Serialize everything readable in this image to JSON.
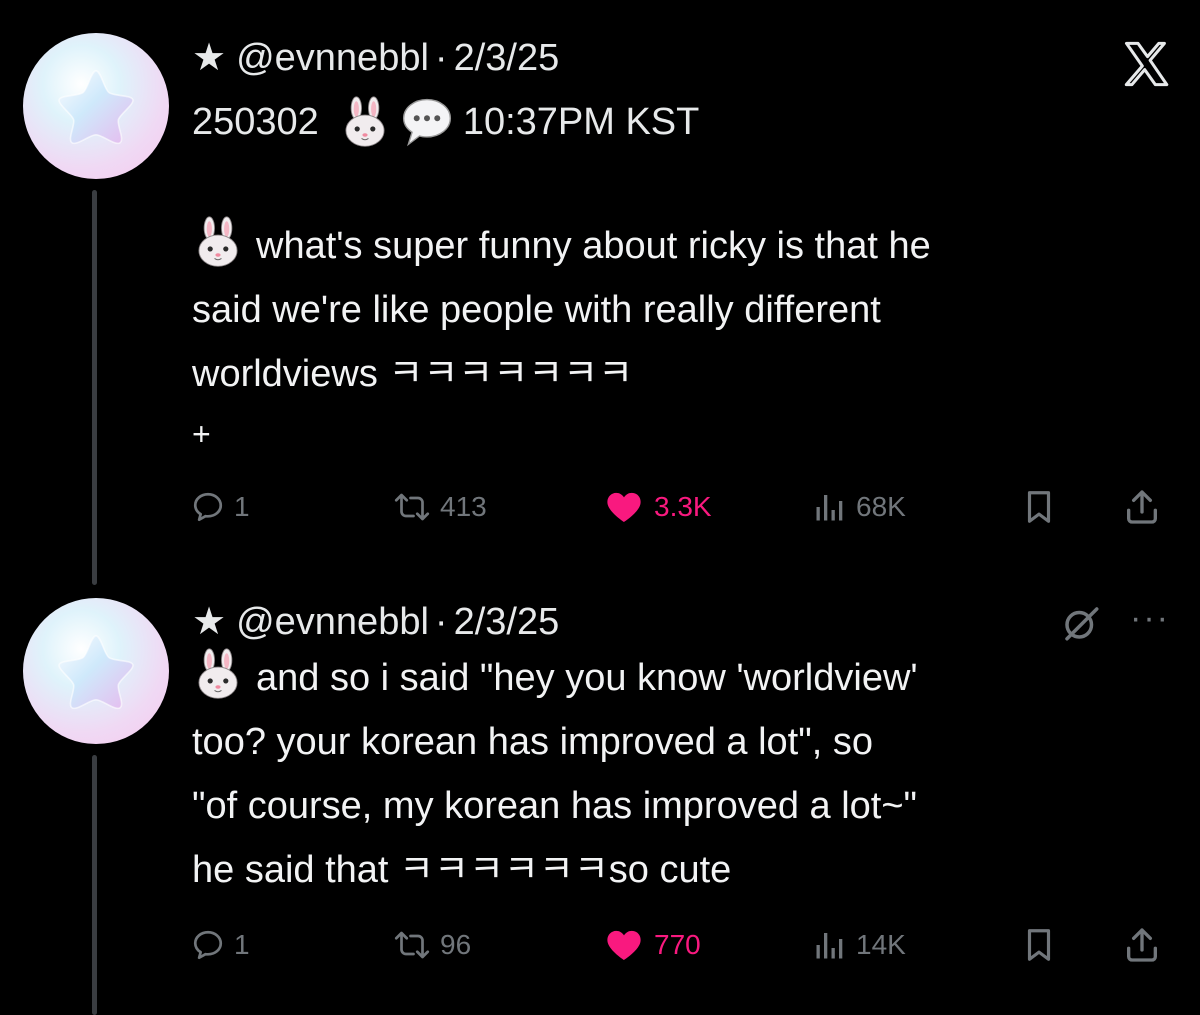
{
  "colors": {
    "background": "#000000",
    "text": "#e7e9ea",
    "muted": "#71767b",
    "like": "#f9197f",
    "thread_line": "#3a3d41"
  },
  "app_logo": "x-logo-icon",
  "tweets": [
    {
      "star": "★",
      "handle": "@evnnebbl",
      "separator": "·",
      "date": "2/3/25",
      "subheader_prefix": "250302",
      "subheader_suffix": "10:37PM KST",
      "lines": [
        "what's super funny about ricky is that he",
        "said we're like people with really different",
        "worldviews ㅋㅋㅋㅋㅋㅋㅋ",
        "+"
      ],
      "replies": "1",
      "reposts": "413",
      "likes": "3.3K",
      "views": "68K"
    },
    {
      "star": "★",
      "handle": "@evnnebbl",
      "separator": "·",
      "date": "2/3/25",
      "lines": [
        "and so i said \"hey you know 'worldview'",
        "too? your korean has improved a lot\", so",
        "\"of course, my korean has improved a lot~\"",
        "he said that ㅋㅋㅋㅋㅋㅋso cute"
      ],
      "more": "···",
      "replies": "1",
      "reposts": "96",
      "likes": "770",
      "views": "14K"
    }
  ]
}
